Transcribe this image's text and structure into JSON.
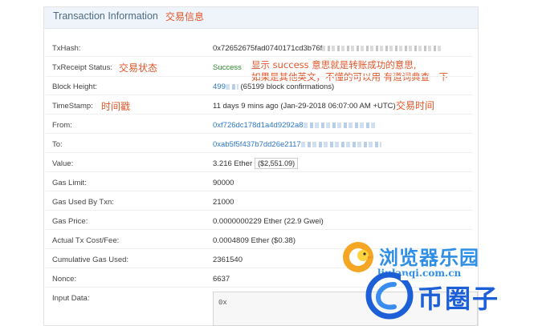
{
  "panel": {
    "title": "Transaction Information"
  },
  "annotations": {
    "title_cn": "交易信息",
    "status_cn": "交易状态",
    "success_note_line1": "显示 success 意思就是转账成功的意思,",
    "success_note_line2": "如果是其他英文，不懂的可以用 有道词典查一下",
    "timestamp_cn": "时间戳",
    "time_cn": "交易时间"
  },
  "fields": {
    "txhash": {
      "label": "TxHash:",
      "value": "0x72652675fad0740171cd3b76f"
    },
    "status": {
      "label": "TxReceipt Status:",
      "value": "Success"
    },
    "block": {
      "label": "Block Height:",
      "value": "499",
      "confirmations": "(65199 block confirmations)"
    },
    "timestamp": {
      "label": "TimeStamp:",
      "value": "11 days 9 mins ago (Jan-29-2018 06:07:00 AM +UTC)"
    },
    "from": {
      "label": "From:",
      "value": "0xf726dc178d1a4d9292a8"
    },
    "to": {
      "label": "To:",
      "value": "0xab5f5f437b7dd26e2117"
    },
    "value": {
      "label": "Value:",
      "value": "3.216 Ether",
      "usd": "($2,551.09)"
    },
    "gas_limit": {
      "label": "Gas Limit:",
      "value": "90000"
    },
    "gas_used": {
      "label": "Gas Used By Txn:",
      "value": "21000"
    },
    "gas_price": {
      "label": "Gas Price:",
      "value": "0.0000000229 Ether (22.9 Gwei)"
    },
    "tx_cost": {
      "label": "Actual Tx Cost/Fee:",
      "value": "0.0004809 Ether ($0.38)"
    },
    "cumulative_gas": {
      "label": "Cumulative Gas Used:",
      "value": "2361540"
    },
    "nonce": {
      "label": "Nonce:",
      "value": "6637"
    },
    "input": {
      "label": "Input Data:",
      "value": "0x"
    }
  },
  "watermarks": {
    "browser_name": "浏览器乐园",
    "browser_url": "liulanqi.com.cn",
    "coin_circle": "币圈子"
  },
  "colors": {
    "link": "#2e78c7",
    "success": "#2f8a2f",
    "annotation": "#e1562a",
    "header_bg": "#eef4f9"
  }
}
